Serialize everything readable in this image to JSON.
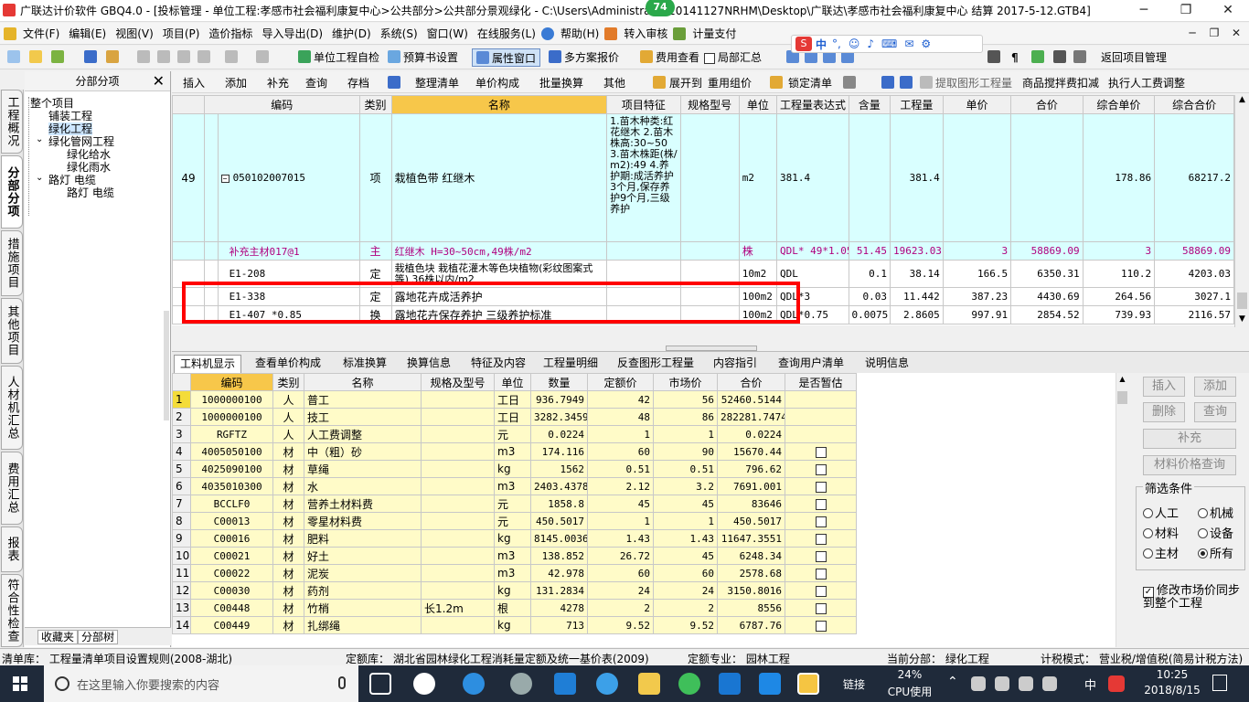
{
  "window": {
    "title": "广联达计价软件 GBQ4.0 - [投标管理 - 单位工程:孝感市社会福利康复中心>公共部分>公共部分景观绿化 - C:\\Users\\Administra... -20141127NRHM\\Desktop\\广联达\\孝感市社会福利康复中心 结算 2017-5-12.GTB4]",
    "badge": "74",
    "minimize": "─",
    "restore": "❐",
    "close": "✕"
  },
  "menu": [
    "文件(F)",
    "编辑(E)",
    "视图(V)",
    "项目(P)",
    "造价指标",
    "导入导出(D)",
    "维护(D)",
    "系统(S)",
    "窗口(W)",
    "在线服务(L)",
    "帮助(H)",
    "转入审核",
    "计量支付"
  ],
  "menu_right": {
    "minimize": "─",
    "restore": "❐",
    "close": "✕"
  },
  "ime": {
    "label": "中",
    "items": [
      "°,",
      "☺",
      "♪",
      "⌨",
      "✉",
      "⚙",
      "⚐"
    ]
  },
  "toolbar1": {
    "check": "单位工程自检",
    "budget": "预算书设置",
    "prop": "属性窗口",
    "multi": "多方案报价",
    "fee": "费用查看",
    "partial": "局部汇总",
    "back": "返回项目管理",
    "para": "¶"
  },
  "toolbar2": {
    "items": [
      "插入",
      "添加",
      "补充",
      "查询",
      "存档",
      "整理清单",
      "单价构成",
      "批量换算",
      "其他",
      "展开到",
      "重用组价",
      "锁定清单",
      "提取图形工程量",
      "商品搅拌费扣减",
      "执行人工费调整"
    ]
  },
  "vtabs": [
    "工程概况",
    "分部分项",
    "措施项目",
    "其他项目",
    "人材机汇总",
    "费用汇总",
    "报表",
    "符合性检查"
  ],
  "tree": {
    "title": "分部分项",
    "close": "✕",
    "items": [
      "整个项目",
      "铺装工程",
      "绿化工程",
      "绿化管网工程",
      "绿化给水",
      "绿化雨水",
      "路灯 电缆",
      "路灯 电缆"
    ],
    "bottom_tabs": [
      "收藏夹",
      "分部树"
    ]
  },
  "top_table": {
    "headers": [
      "编码",
      "类别",
      "名称",
      "项目特征",
      "规格型号",
      "单位",
      "工程量表达式",
      "含量",
      "工程量",
      "单价",
      "合价",
      "综合单价",
      "综合合价"
    ],
    "main_row": {
      "no": "49",
      "code": "050102007015",
      "type": "项",
      "name": "栽植色带 红继木",
      "feature": "1.苗木种类:红花继木 2.苗木株高:30~50 3.苗木株距(株/m2):49 4.养护期:成活养护3个月,保存养护9个月,三级养护",
      "unit": "m2",
      "expr": "381.4",
      "qty": "381.4",
      "uprice": "178.86",
      "total": "68217.2"
    },
    "sub_rows": [
      {
        "code": "补充主材017@1",
        "type": "主",
        "name": "红继木 H=30~50cm,49株/m2",
        "spec": "",
        "unit": "株",
        "expr": "QDL* 49*1.05",
        "content": "51.45",
        "qty": "19623.03",
        "price": "3",
        "sum": "58869.09",
        "cprice": "3",
        "csum": "58869.09",
        "pink": true
      },
      {
        "code": "E1-208",
        "type": "定",
        "name": "栽植色块 栽植花灌木等色块植物(彩纹图案式等) 36株以内/m2",
        "spec": "",
        "unit": "10m2",
        "expr": "QDL",
        "content": "0.1",
        "qty": "38.14",
        "price": "166.5",
        "sum": "6350.31",
        "cprice": "110.2",
        "csum": "4203.03",
        "pink": false
      },
      {
        "code": "E1-338",
        "type": "定",
        "name": "露地花卉成活养护",
        "spec": "",
        "unit": "100m2",
        "expr": "QDL*3",
        "content": "0.03",
        "qty": "11.442",
        "price": "387.23",
        "sum": "4430.69",
        "cprice": "264.56",
        "csum": "3027.1",
        "pink": false
      },
      {
        "code": "E1-407 *0.85",
        "type": "换",
        "name": "露地花卉保存养护 三级养护标准",
        "spec": "",
        "unit": "100m2",
        "expr": "QDL*0.75",
        "content": "0.0075",
        "qty": "2.8605",
        "price": "997.91",
        "sum": "2854.52",
        "cprice": "739.93",
        "csum": "2116.57",
        "pink": false
      }
    ]
  },
  "mid_tabs": [
    "工料机显示",
    "查看单价构成",
    "标准换算",
    "换算信息",
    "特征及内容",
    "工程量明细",
    "反查图形工程量",
    "内容指引",
    "查询用户清单",
    "说明信息"
  ],
  "bottom_table": {
    "headers": [
      "",
      "编码",
      "类别",
      "名称",
      "规格及型号",
      "单位",
      "数量",
      "定额价",
      "市场价",
      "合价",
      "是否暂估"
    ],
    "rows": [
      [
        "1",
        "1000000100",
        "人",
        "普工",
        "",
        "工日",
        "936.7949",
        "42",
        "56",
        "52460.5144",
        ""
      ],
      [
        "2",
        "1000000100",
        "人",
        "技工",
        "",
        "工日",
        "3282.3459",
        "48",
        "86",
        "282281.7474",
        ""
      ],
      [
        "3",
        "RGFTZ",
        "人",
        "人工费调整",
        "",
        "元",
        "0.0224",
        "1",
        "1",
        "0.0224",
        ""
      ],
      [
        "4",
        "4005050100",
        "材",
        "中（粗）砂",
        "",
        "m3",
        "174.116",
        "60",
        "90",
        "15670.44",
        "cb"
      ],
      [
        "5",
        "4025090100",
        "材",
        "草绳",
        "",
        "kg",
        "1562",
        "0.51",
        "0.51",
        "796.62",
        "cb"
      ],
      [
        "6",
        "4035010300",
        "材",
        "水",
        "",
        "m3",
        "2403.4378",
        "2.12",
        "3.2",
        "7691.001",
        "cb"
      ],
      [
        "7",
        "BCCLF0",
        "材",
        "营养土材料费",
        "",
        "元",
        "1858.8",
        "45",
        "45",
        "83646",
        "cb"
      ],
      [
        "8",
        "C00013",
        "材",
        "零星材料费",
        "",
        "元",
        "450.5017",
        "1",
        "1",
        "450.5017",
        "cb"
      ],
      [
        "9",
        "C00016",
        "材",
        "肥料",
        "",
        "kg",
        "8145.0036",
        "1.43",
        "1.43",
        "11647.3551",
        "cb"
      ],
      [
        "10",
        "C00021",
        "材",
        "好土",
        "",
        "m3",
        "138.852",
        "26.72",
        "45",
        "6248.34",
        "cb"
      ],
      [
        "11",
        "C00022",
        "材",
        "泥炭",
        "",
        "m3",
        "42.978",
        "60",
        "60",
        "2578.68",
        "cb"
      ],
      [
        "12",
        "C00030",
        "材",
        "药剂",
        "",
        "kg",
        "131.2834",
        "24",
        "24",
        "3150.8016",
        "cb"
      ],
      [
        "13",
        "C00448",
        "材",
        "竹梢",
        "长1.2m",
        "根",
        "4278",
        "2",
        "2",
        "8556",
        "cb"
      ],
      [
        "14",
        "C00449",
        "材",
        "扎绑绳",
        "",
        "kg",
        "713",
        "9.52",
        "9.52",
        "6787.76",
        "cb"
      ]
    ]
  },
  "right_panel": {
    "buttons": [
      "插入",
      "添加",
      "删除",
      "查询",
      "补充",
      "材料价格查询"
    ],
    "filter_title": "筛选条件",
    "radios": [
      "人工",
      "机械",
      "材料",
      "设备",
      "主材",
      "所有"
    ],
    "selected": "所有",
    "sync_label": "修改市场价同步到整个工程"
  },
  "status": {
    "list": "清单库：  工程量清单项目设置规则(2008-湖北)",
    "quota": "定额库：  湖北省园林绿化工程消耗量定额及统一基价表(2009)",
    "major": "定额专业：  园林工程",
    "current": "当前分部：  绿化工程",
    "tax": "计税模式：  营业税/增值税(简易计税方法)"
  },
  "taskbar": {
    "search_placeholder": "在这里输入你要搜索的内容",
    "link": "链接",
    "cpu_pct": "24%",
    "cpu_label": "CPU使用",
    "ime": "中",
    "time": "10:25",
    "date": "2018/8/15"
  }
}
